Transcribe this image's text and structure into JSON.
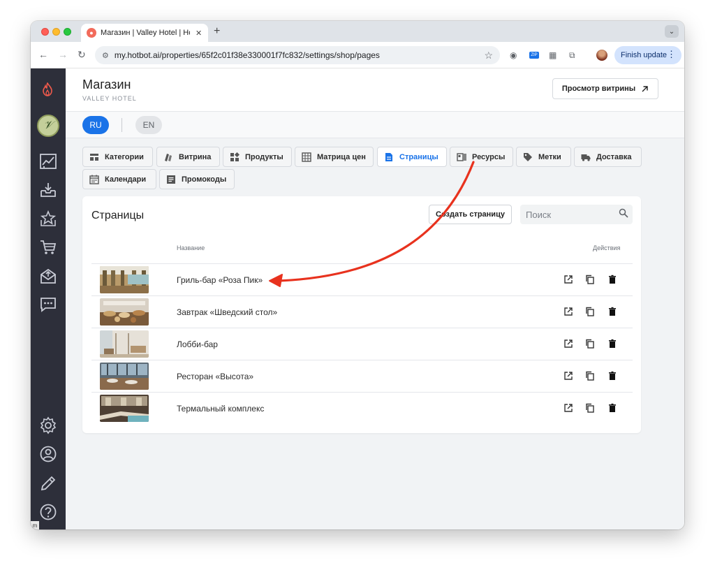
{
  "browser": {
    "tab_title": "Магазин | Valley Hotel | Hotbot",
    "url": "my.hotbot.ai/properties/65f2c01f38e330001f7fc832/settings/shop/pages",
    "finish_update_label": "Finish update",
    "zip_badge": "ZIP"
  },
  "header": {
    "title": "Магазин",
    "subtitle": "VALLEY HOTEL",
    "preview_button": "Просмотр витрины"
  },
  "languages": [
    {
      "code": "RU",
      "active": true
    },
    {
      "code": "EN",
      "active": false
    }
  ],
  "nav_tabs": [
    {
      "label": "Категории",
      "icon": "category-icon",
      "active": false
    },
    {
      "label": "Витрина",
      "icon": "storefront-icon",
      "active": false
    },
    {
      "label": "Продукты",
      "icon": "products-icon",
      "active": false
    },
    {
      "label": "Матрица цен",
      "icon": "price-matrix-icon",
      "active": false
    },
    {
      "label": "Страницы",
      "icon": "pages-icon",
      "active": true
    },
    {
      "label": "Ресурсы",
      "icon": "resources-icon",
      "active": false
    },
    {
      "label": "Метки",
      "icon": "tag-icon",
      "active": false
    },
    {
      "label": "Доставка",
      "icon": "truck-icon",
      "active": false
    },
    {
      "label": "Календари",
      "icon": "calendar-icon",
      "active": false
    },
    {
      "label": "Промокоды",
      "icon": "promo-icon",
      "active": false
    }
  ],
  "pages_card": {
    "title": "Страницы",
    "create_button": "Создать страницу",
    "search_placeholder": "Поиск",
    "columns": {
      "name": "Название",
      "actions": "Действия"
    },
    "rows": [
      {
        "name": "Гриль-бар «Роза Пик»"
      },
      {
        "name": "Завтрак «Шведский стол»"
      },
      {
        "name": "Лобби-бар"
      },
      {
        "name": "Ресторан «Высота»"
      },
      {
        "name": "Термальный комплекс"
      }
    ]
  },
  "sidebar_icons": [
    "flame-icon",
    "hotel-logo-icon",
    "analytics-icon",
    "inbox-icon",
    "rating-icon",
    "cart-icon",
    "mail-icon",
    "chat-icon",
    "settings-icon",
    "account-icon",
    "edit-icon",
    "help-icon"
  ],
  "colors": {
    "accent": "#1a73e8",
    "sidebar": "#2d2f3a",
    "arrow": "#e8321e"
  }
}
